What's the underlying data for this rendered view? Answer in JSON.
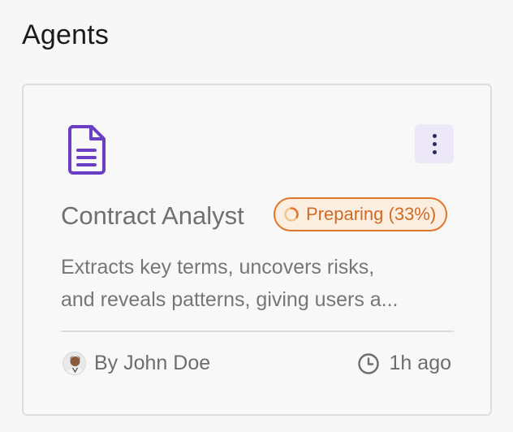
{
  "page": {
    "title": "Agents"
  },
  "card": {
    "name": "Contract Analyst",
    "status": {
      "label": "Preparing (33%)",
      "progress_percent": 33,
      "color": "#e0752b"
    },
    "description_lines": [
      "Extracts key terms, uncovers risks,",
      "and reveals patterns, giving users a..."
    ],
    "author": "By John Doe",
    "time": "1h ago",
    "icon": "document-icon",
    "accent_color": "#6b3fc4"
  }
}
